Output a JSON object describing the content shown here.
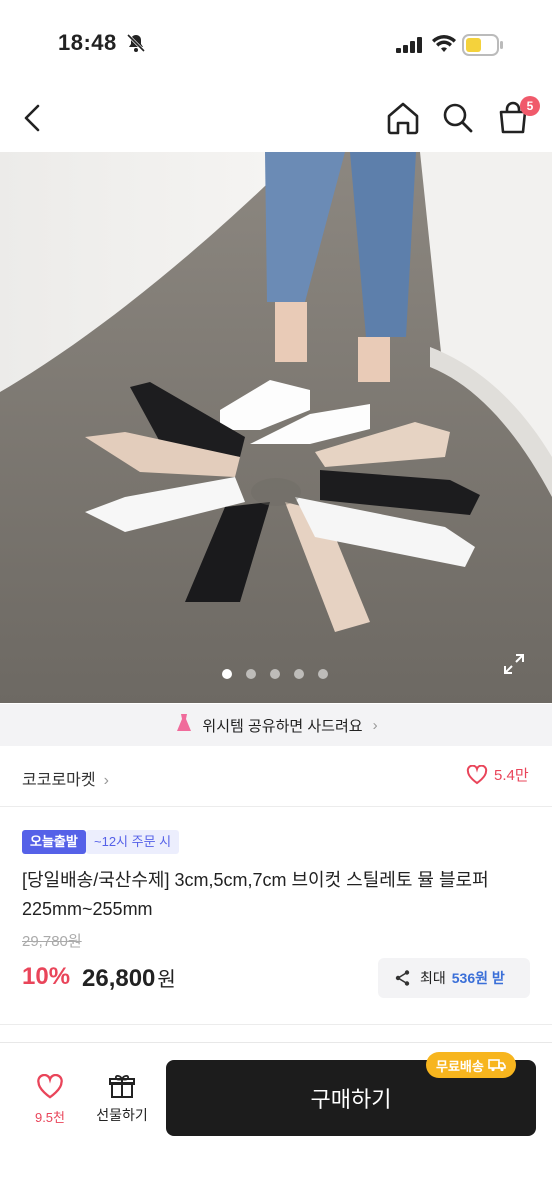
{
  "status_bar": {
    "time": "18:48"
  },
  "header": {
    "cart_count": "5"
  },
  "gallery": {
    "image_count": 5,
    "active_index": 0
  },
  "share_banner": {
    "text": "위시템 공유하면 사드려요"
  },
  "store": {
    "name": "코코로마켓",
    "likes": "5.4만"
  },
  "product": {
    "tag_primary": "오늘출발",
    "tag_secondary": "~12시 주문 시",
    "title": "[당일배송/국산수제] 3cm,5cm,7cm 브이컷 스틸레토 뮬 블로퍼 225mm~255mm",
    "original_price": "29,780원",
    "discount": "10%",
    "price": "26,800",
    "price_unit": "원",
    "max_share_label": "최대",
    "max_share_amount": "536원 받"
  },
  "bottom_bar": {
    "wish_count": "9.5천",
    "gift_label": "선물하기",
    "buy_label": "구매하기",
    "free_shipping": "무료배송"
  },
  "colors": {
    "accent": "#e9455a",
    "tag": "#5561e8",
    "buy": "#1c1c1c",
    "ship": "#f7b51e"
  }
}
